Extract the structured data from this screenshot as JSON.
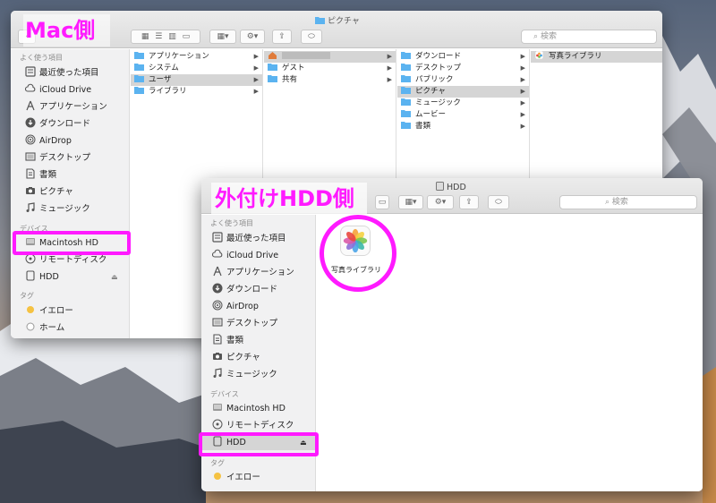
{
  "colors": {
    "highlight": "#ff1aff",
    "folder": "#5bb3f0",
    "selection": "#d5d5d5",
    "tag_yellow": "#f5c242"
  },
  "annotations": {
    "mac_label": "Mac側",
    "hdd_label": "外付けHDD側"
  },
  "mac_window": {
    "title": "ピクチャ",
    "search_placeholder": "検索",
    "sidebar": {
      "favorites_header": "よく使う項目",
      "favorites": [
        {
          "label": "最近使った項目",
          "icon": "recents-icon"
        },
        {
          "label": "iCloud Drive",
          "icon": "cloud-icon"
        },
        {
          "label": "アプリケーション",
          "icon": "applications-icon"
        },
        {
          "label": "ダウンロード",
          "icon": "download-icon"
        },
        {
          "label": "AirDrop",
          "icon": "airdrop-icon"
        },
        {
          "label": "デスクトップ",
          "icon": "desktop-icon"
        },
        {
          "label": "書類",
          "icon": "documents-icon"
        },
        {
          "label": "ピクチャ",
          "icon": "camera-icon"
        },
        {
          "label": "ミュージック",
          "icon": "music-icon"
        }
      ],
      "devices_header": "デバイス",
      "devices": [
        {
          "label": "Macintosh HD",
          "icon": "hard-drive-icon"
        },
        {
          "label": "リモートディスク",
          "icon": "disc-icon"
        },
        {
          "label": "HDD",
          "icon": "external-drive-icon"
        }
      ],
      "tags_header": "タグ",
      "tags": [
        {
          "label": "イエロー",
          "icon": "yellow-tag-icon"
        },
        {
          "label": "ホーム",
          "icon": "gray-tag-icon"
        }
      ]
    },
    "columns": [
      {
        "items": [
          {
            "label": "アプリケーション",
            "selected": false
          },
          {
            "label": "システム",
            "selected": false
          },
          {
            "label": "ユーザ",
            "selected": true
          },
          {
            "label": "ライブラリ",
            "selected": false
          }
        ]
      },
      {
        "items": [
          {
            "label": "",
            "selected": true,
            "icon": "home-icon"
          },
          {
            "label": "ゲスト",
            "selected": false
          },
          {
            "label": "共有",
            "selected": false
          }
        ]
      },
      {
        "items": [
          {
            "label": "ダウンロード",
            "selected": false
          },
          {
            "label": "デスクトップ",
            "selected": false
          },
          {
            "label": "パブリック",
            "selected": false
          },
          {
            "label": "ピクチャ",
            "selected": true
          },
          {
            "label": "ミュージック",
            "selected": false
          },
          {
            "label": "ムービー",
            "selected": false
          },
          {
            "label": "書類",
            "selected": false
          }
        ]
      },
      {
        "items": [
          {
            "label": "写真ライブラリ",
            "selected": true,
            "icon": "photos-icon"
          }
        ]
      }
    ]
  },
  "hdd_window": {
    "title": "HDD",
    "search_placeholder": "検索",
    "sidebar": {
      "favorites_header": "よく使う項目",
      "favorites": [
        {
          "label": "最近使った項目"
        },
        {
          "label": "iCloud Drive"
        },
        {
          "label": "アプリケーション"
        },
        {
          "label": "ダウンロード"
        },
        {
          "label": "AirDrop"
        },
        {
          "label": "デスクトップ"
        },
        {
          "label": "書類"
        },
        {
          "label": "ピクチャ"
        },
        {
          "label": "ミュージック"
        }
      ],
      "devices_header": "デバイス",
      "devices": [
        {
          "label": "Macintosh HD"
        },
        {
          "label": "リモートディスク"
        },
        {
          "label": "HDD"
        }
      ],
      "tags_header": "タグ",
      "tags": [
        {
          "label": "イエロー"
        }
      ]
    },
    "content": {
      "items": [
        {
          "label": "写真ライブラリ",
          "icon": "photos-library-icon"
        }
      ]
    }
  }
}
